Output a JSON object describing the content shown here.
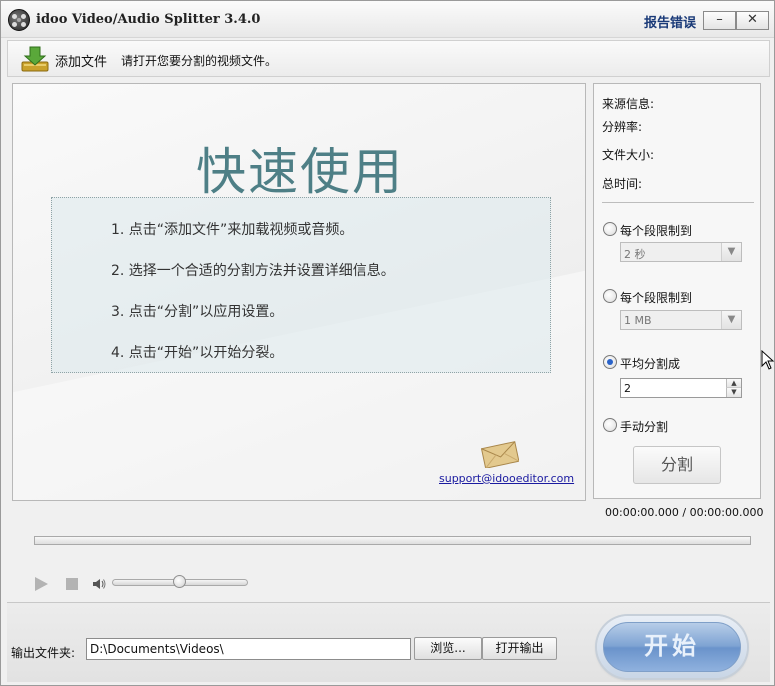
{
  "window": {
    "title": "idoo Video/Audio Splitter 3.4.0",
    "report_error": "报告错误",
    "minimize_symbol": "–",
    "close_symbol": "✕"
  },
  "toolbar": {
    "add_file_label": "添加文件",
    "hint": "请打开您要分割的视频文件。",
    "add_file_icon": "download-arrow-icon"
  },
  "quick_start": {
    "title": "快速使用",
    "steps": [
      "1. 点击“添加文件”来加载视频或音频。",
      "2. 选择一个合适的分割方法并设置详细信息。",
      "3. 点击“分割”以应用设置。",
      "4. 点击“开始”以开始分裂。"
    ],
    "support_email": "support@idooeditor.com",
    "mail_icon": "envelope-icon"
  },
  "source_info": {
    "source_label": "来源信息:",
    "resolution_label": "分辨率:",
    "file_size_label": "文件大小:",
    "total_time_label": "总时间:"
  },
  "split_options": {
    "by_time_label": "每个段限制到",
    "by_time_value": "2 秒",
    "by_size_label": "每个段限制到",
    "by_size_value": "1 MB",
    "average_label": "平均分割成",
    "average_value": "2",
    "manual_label": "手动分割",
    "selected": "average",
    "split_button": "分割"
  },
  "playback": {
    "time_readout": "00:00:00.000 / 00:00:00.000",
    "progress": 0,
    "volume": 0.49
  },
  "output": {
    "label": "输出文件夹:",
    "path": "D:\\Documents\\Videos\\",
    "browse_button": "浏览...",
    "open_output_button": "打开输出",
    "start_button": "开始"
  },
  "colors": {
    "title_accent": "#4e7f86",
    "link": "#1a1aa0",
    "report_error": "#1a3a78",
    "start_button": "#7ea3d3",
    "radio_selected": "#2a63c9"
  }
}
